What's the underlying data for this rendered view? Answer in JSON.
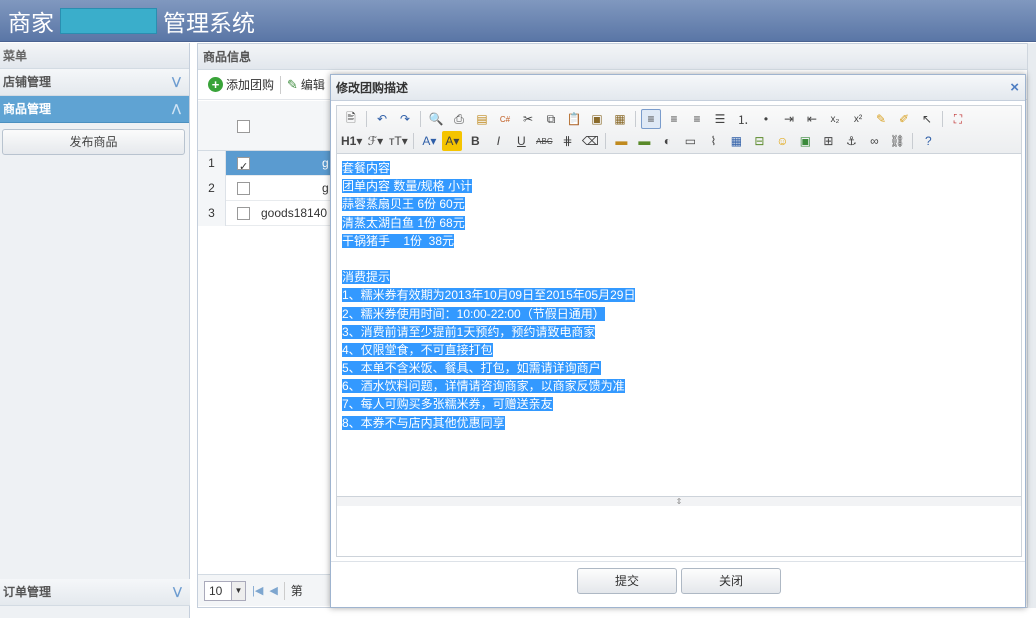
{
  "header": {
    "title_left": "商家",
    "title_right": "管理系统"
  },
  "sidebar": {
    "title": "菜单",
    "groups": [
      {
        "label": "店铺管理"
      },
      {
        "label": "商品管理"
      }
    ],
    "publish_button": "发布商品",
    "bottom_group": {
      "label": "订单管理"
    }
  },
  "main": {
    "title": "商品信息",
    "toolbar": {
      "add": "添加团购",
      "edit": "编辑"
    },
    "rows": [
      {
        "num": "1",
        "name": "g"
      },
      {
        "num": "2",
        "name": "g"
      },
      {
        "num": "3",
        "name": "goods18140"
      }
    ],
    "pager": {
      "page_size": "10",
      "page_prefix": "第"
    }
  },
  "dialog": {
    "title": "修改团购描述",
    "close_icon": "×",
    "toolbar_row1": [
      "source",
      "undo",
      "redo",
      "preview",
      "print",
      "template",
      "code",
      "cut",
      "copy",
      "paste",
      "paste-text",
      "paste-word",
      "align-left",
      "align-center",
      "align-right",
      "justify",
      "ordered-list",
      "unordered-list",
      "indent",
      "outdent",
      "subscript",
      "superscript",
      "clear-format",
      "select-all",
      "pointer",
      "fullscreen"
    ],
    "toolbar_row2": [
      "heading",
      "font-family",
      "font-size",
      "font-color",
      "highlight",
      "bold",
      "italic",
      "underline",
      "strikethrough",
      "line-height",
      "eraser",
      "image",
      "multi-image",
      "flash",
      "media",
      "attachment",
      "table",
      "insert-hr",
      "emoticon",
      "map",
      "page-break",
      "anchor",
      "link",
      "unlink",
      "help"
    ],
    "toolbar_labels": {
      "heading": "H1",
      "font_family": "ℱ",
      "font_size": "тT",
      "font_color": "A",
      "highlight": "A",
      "bold": "B",
      "italic": "I",
      "underline": "U",
      "strike": "ABC"
    },
    "content_lines": [
      "套餐内容",
      "团单内容  数量/规格  小计",
      "蒜蓉蒸扇贝王  6份  60元",
      "清蒸太湖白鱼  1份  68元",
      "干锅猪手    1份  38元",
      "",
      "消费提示",
      "1、糯米券有效期为2013年10月09日至2015年05月29日",
      "2、糯米券使用时间：10:00-22:00（节假日通用）",
      "3、消费前请至少提前1天预约，预约请致电商家",
      "4、仅限堂食，不可直接打包",
      "5、本单不含米饭、餐具、打包，如需请详询商户",
      "6、酒水饮料问题，详情请咨询商家，以商家反馈为准",
      "7、每人可购买多张糯米券，可赠送亲友",
      "8、本券不与店内其他优惠同享"
    ],
    "submit_label": "提交",
    "close_label": "关闭"
  },
  "colors": {
    "header_bg": "#5a76a6",
    "active_menu": "#5fa3d3",
    "selection": "#3399ff",
    "redaction": "#3aaecb"
  }
}
